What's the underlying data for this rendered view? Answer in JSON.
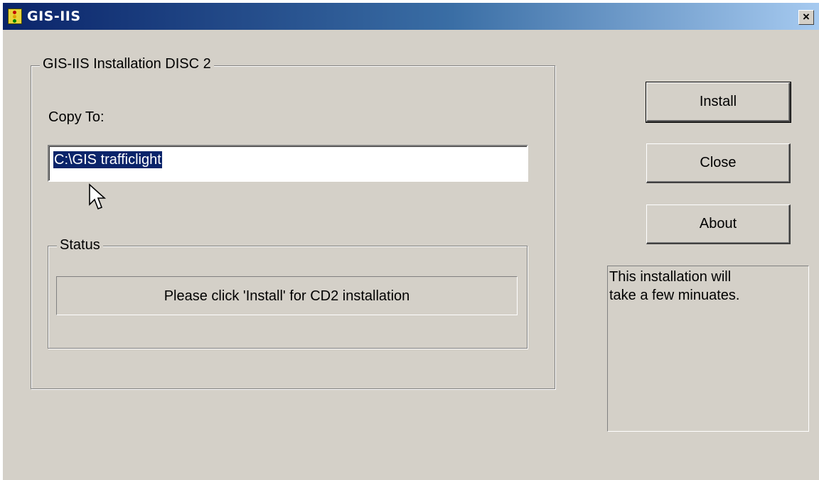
{
  "window": {
    "title": "GIS-IIS",
    "close_glyph": "×"
  },
  "install_group": {
    "title": "GIS-IIS Installation DISC 2",
    "copy_to_label": "Copy To:",
    "copy_to_value": "C:\\GIS trafficlight"
  },
  "status_group": {
    "title": "Status",
    "message": "Please click 'Install' for CD2 installation"
  },
  "buttons": {
    "install": "Install",
    "close": "Close",
    "about": "About"
  },
  "info": {
    "text_line1": "This installation will",
    "text_line2": "take a few minuates."
  },
  "icons": {
    "app": "traffic-light-icon",
    "cursor": "mouse-pointer-icon"
  },
  "colors": {
    "title_gradient_start": "#0a246a",
    "title_gradient_end": "#a6caf0",
    "dialog_bg": "#d4d0c8",
    "selection": "#0a246a"
  }
}
